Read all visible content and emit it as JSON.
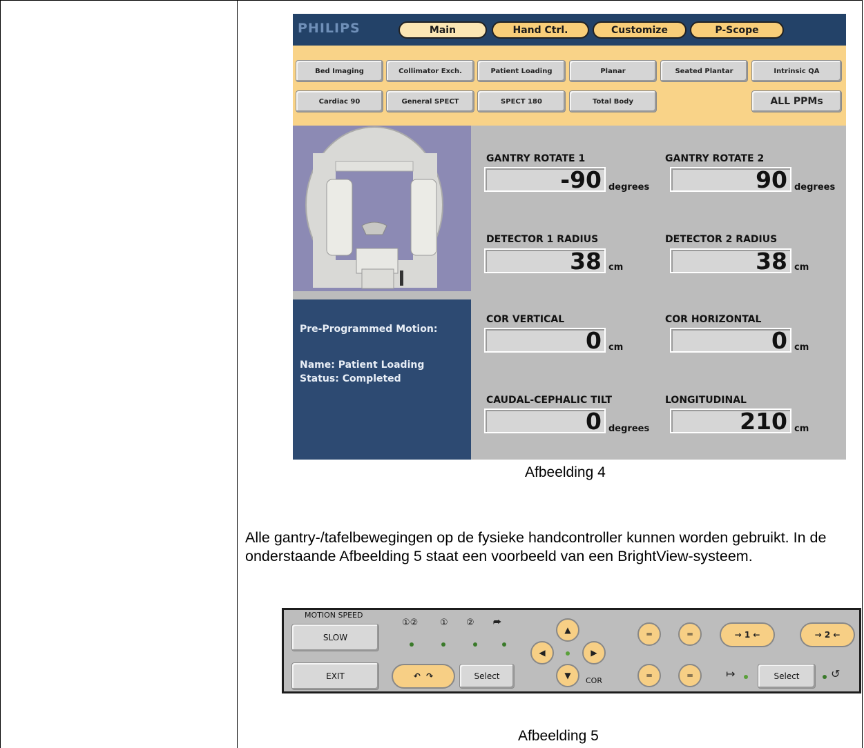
{
  "screen1": {
    "logo": "PHILIPS",
    "tabs": [
      "Main",
      "Hand Ctrl.",
      "Customize",
      "P-Scope"
    ],
    "buttons_row1": [
      "Bed Imaging",
      "Collimator Exch.",
      "Patient Loading",
      "Planar",
      "Seated Plantar",
      "Intrinsic QA"
    ],
    "buttons_row2": [
      "Cardiac 90",
      "General SPECT",
      "SPECT 180",
      "Total Body"
    ],
    "all_ppms": "ALL PPMs",
    "ppm": {
      "title": "Pre-Programmed Motion:",
      "name": "Name: Patient Loading",
      "status": "Status: Completed"
    },
    "fields": [
      {
        "label": "GANTRY ROTATE 1",
        "value": "-90",
        "unit": "degrees"
      },
      {
        "label": "GANTRY ROTATE 2",
        "value": "90",
        "unit": "degrees"
      },
      {
        "label": "DETECTOR 1 RADIUS",
        "value": "38",
        "unit": "cm"
      },
      {
        "label": "DETECTOR 2 RADIUS",
        "value": "38",
        "unit": "cm"
      },
      {
        "label": "COR VERTICAL",
        "value": "0",
        "unit": "cm"
      },
      {
        "label": "COR HORIZONTAL",
        "value": "0",
        "unit": "cm"
      },
      {
        "label": "CAUDAL-CEPHALIC TILT",
        "value": "0",
        "unit": "degrees"
      },
      {
        "label": "LONGITUDINAL",
        "value": "210",
        "unit": "cm"
      }
    ]
  },
  "caption1": "Afbeelding 4",
  "paragraph": "Alle gantry-/tafelbewegingen op de fysieke handcontroller kunnen worden gebruikt. In de onderstaande Afbeelding 5 staat een voorbeeld van een BrightView-systeem.",
  "screen2": {
    "motion_speed_label": "MOTION SPEED",
    "slow": "SLOW",
    "exit": "EXIT",
    "select1": "Select",
    "select2": "Select",
    "cor": "COR",
    "det1": "1",
    "det2": "2"
  },
  "caption2": "Afbeelding 5"
}
